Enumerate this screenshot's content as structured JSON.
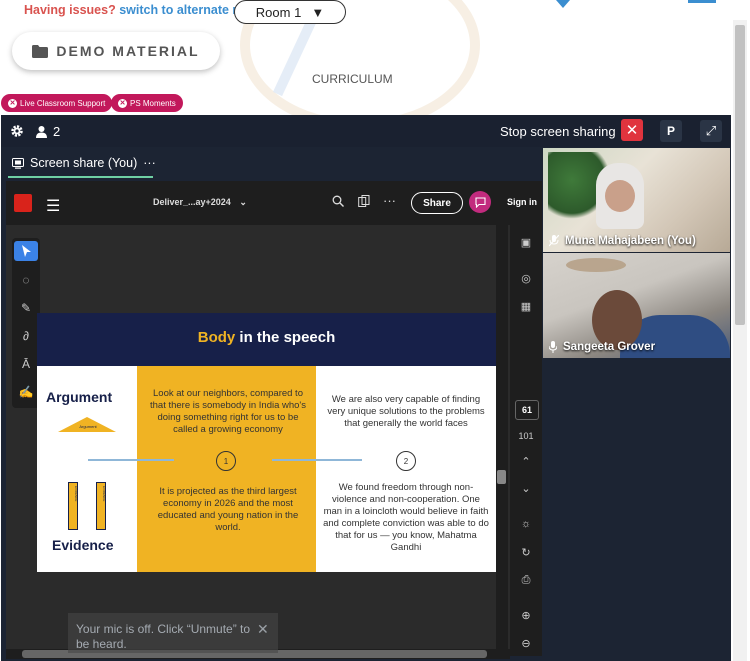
{
  "top": {
    "issue_prefix": "Having issues?",
    "issue_link": "switch to alternate room",
    "room_label": "Room 1",
    "room_caret": "▼",
    "demo_label": "DEMO MATERIAL",
    "curriculum": "CURRICULUM",
    "pills": [
      "Live Classroom Support",
      "PS Moments"
    ]
  },
  "meeting": {
    "participant_count": "2",
    "stop_sharing_label": "Stop screen sharing",
    "stop_close": "✕",
    "p_label": "P",
    "expand": "⤢",
    "tab_label": "Screen share (You)",
    "tab_more": "···"
  },
  "acrobat": {
    "file_name": "Deliver_...ay+2024",
    "share_label": "Share",
    "signin_label": "Sign in",
    "page_current": "61",
    "page_total": "101"
  },
  "slide": {
    "title_highlight": "Body",
    "title_rest": " in the speech",
    "argument_label": "Argument",
    "argument_mini": "Argument",
    "evidence_label": "Evidence",
    "evidence_bar_text": "EVIDENCE",
    "arg_yellow": "Look at our neighbors, compared to that there is somebody in India who's doing something right for us to be called a growing economy",
    "arg_white": "We are also very capable of finding very unique solutions to the problems that generally the world faces",
    "num1": "1",
    "num2": "2",
    "ev_yellow": "It is projected as the third largest economy in 2026 and the most educated and young nation in the world.",
    "ev_white": "We found freedom through non-violence and non-cooperation. One man in a loincloth would believe in faith and complete conviction was able to do that for us — you know, Mahatma Gandhi"
  },
  "videos": [
    {
      "name": "Muna Mahajabeen (You)"
    },
    {
      "name": "Sangeeta Grover"
    }
  ],
  "toast": {
    "text": "Your mic is off. Click “Unmute” to be heard.",
    "close": "✕"
  },
  "colors": {
    "accent_red": "#e0343e",
    "pill": "#c2185b",
    "slide_navy": "#172049",
    "slide_yellow": "#f0b323"
  }
}
